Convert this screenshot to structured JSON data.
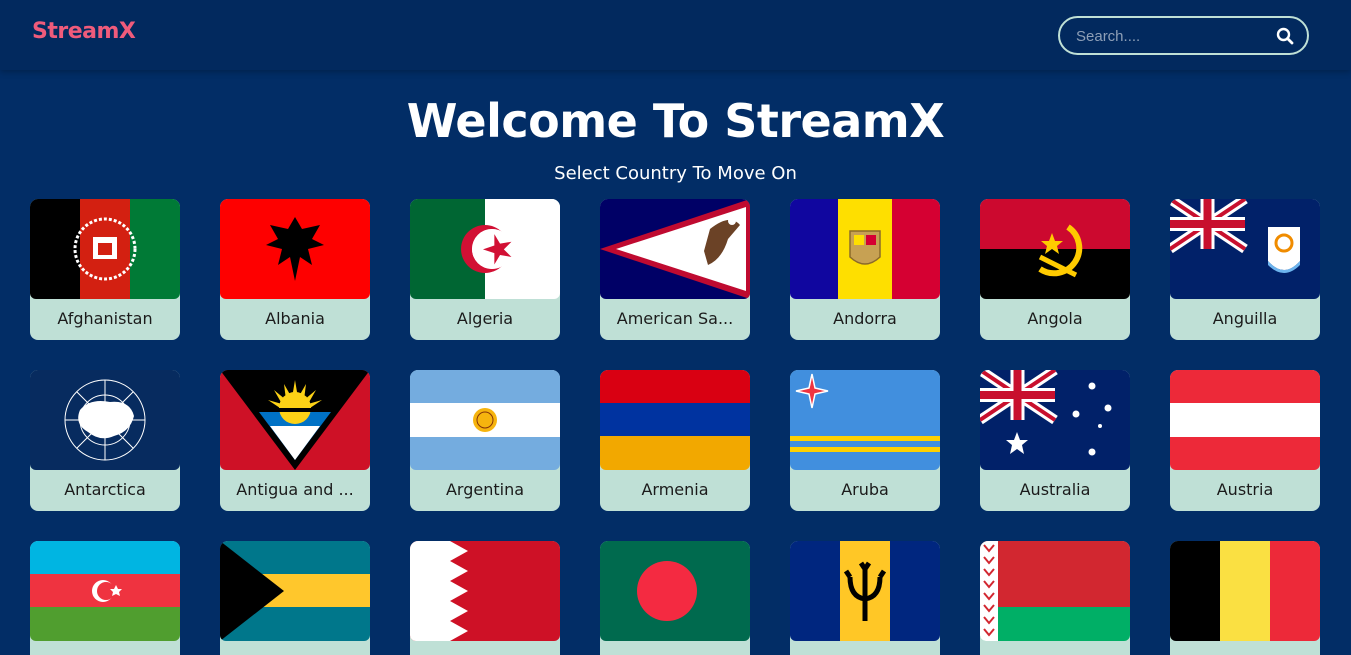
{
  "header": {
    "brand": "StreamX",
    "search": {
      "placeholder": "Search...."
    }
  },
  "hero": {
    "title": "Welcome To StreamX",
    "subtitle": "Select Country To Move On"
  },
  "countries": [
    {
      "name": "Afghanistan",
      "flag_icon": "afghanistan-flag-icon"
    },
    {
      "name": "Albania",
      "flag_icon": "albania-flag-icon"
    },
    {
      "name": "Algeria",
      "flag_icon": "algeria-flag-icon"
    },
    {
      "name": "American Sa...",
      "flag_icon": "american-samoa-flag-icon"
    },
    {
      "name": "Andorra",
      "flag_icon": "andorra-flag-icon"
    },
    {
      "name": "Angola",
      "flag_icon": "angola-flag-icon"
    },
    {
      "name": "Anguilla",
      "flag_icon": "anguilla-flag-icon"
    },
    {
      "name": "Antarctica",
      "flag_icon": "antarctica-flag-icon"
    },
    {
      "name": "Antigua and ...",
      "flag_icon": "antigua-and-barbuda-flag-icon"
    },
    {
      "name": "Argentina",
      "flag_icon": "argentina-flag-icon"
    },
    {
      "name": "Armenia",
      "flag_icon": "armenia-flag-icon"
    },
    {
      "name": "Aruba",
      "flag_icon": "aruba-flag-icon"
    },
    {
      "name": "Australia",
      "flag_icon": "australia-flag-icon"
    },
    {
      "name": "Austria",
      "flag_icon": "austria-flag-icon"
    },
    {
      "name": "",
      "flag_icon": "azerbaijan-flag-icon"
    },
    {
      "name": "",
      "flag_icon": "bahamas-flag-icon"
    },
    {
      "name": "",
      "flag_icon": "bahrain-flag-icon"
    },
    {
      "name": "",
      "flag_icon": "bangladesh-flag-icon"
    },
    {
      "name": "",
      "flag_icon": "barbados-flag-icon"
    },
    {
      "name": "",
      "flag_icon": "belarus-flag-icon"
    },
    {
      "name": "",
      "flag_icon": "belgium-flag-icon"
    }
  ],
  "colors": {
    "background": "#022d66",
    "brand": "#ef5b7b",
    "card": "#bfe0d6"
  }
}
